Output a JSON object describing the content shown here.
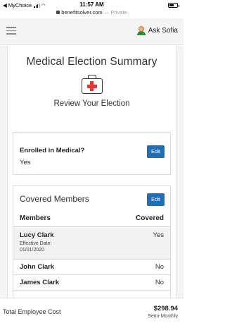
{
  "status_bar": {
    "back_app": "◀ MyChoice",
    "time": "11:57 AM",
    "url": "benefitsolver.com",
    "url_suffix": "— Private"
  },
  "app_bar": {
    "ask_label": "Ask Sofia",
    "menu_icon": "hamburger-icon",
    "avatar_icon": "sofia-avatar-icon"
  },
  "summary": {
    "title": "Medical Election Summary",
    "subtitle": "Review Your Election",
    "icon": "medical-kit-icon"
  },
  "enrolled": {
    "question": "Enrolled in Medical?",
    "answer": "Yes",
    "edit_label": "Edit"
  },
  "covered": {
    "title": "Covered Members",
    "edit_label": "Edit",
    "col_members": "Members",
    "col_covered": "Covered",
    "rows": [
      {
        "name": "Lucy Clark",
        "covered": "Yes",
        "effective_label": "Effective Date:",
        "effective_date": "01/01/2020"
      },
      {
        "name": "John Clark",
        "covered": "No"
      },
      {
        "name": "James Clark",
        "covered": "No"
      }
    ]
  },
  "footer": {
    "total_label": "Total Employee Cost",
    "amount": "$298.94",
    "frequency": "Semi-Monthly"
  },
  "colors": {
    "accent": "#1f6fb8",
    "cross": "#e53935",
    "avatar_shirt": "#2a8a3e"
  }
}
